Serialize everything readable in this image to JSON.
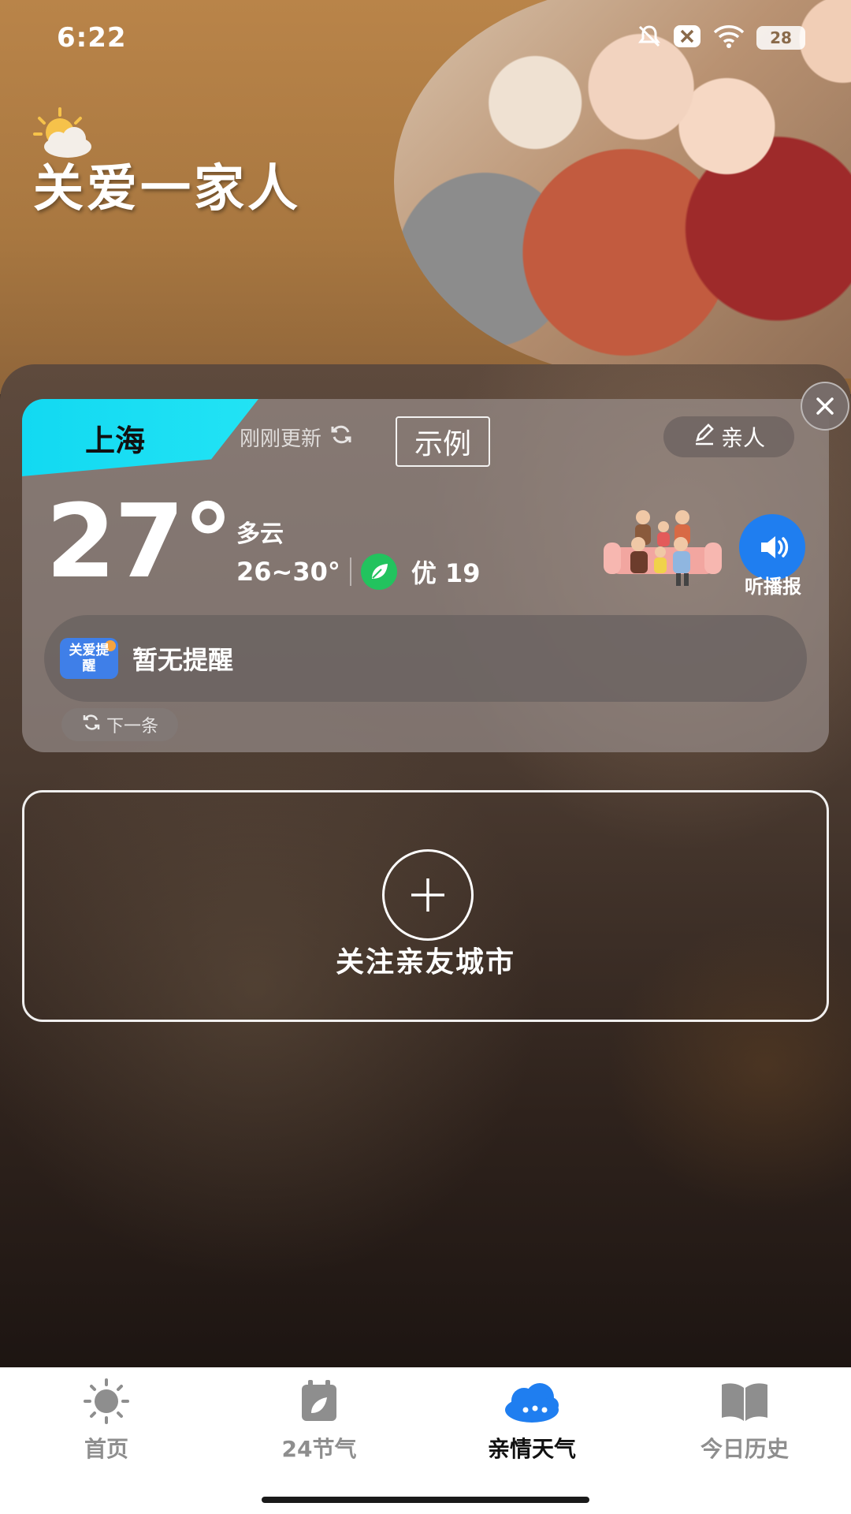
{
  "status_bar": {
    "time": "6:22",
    "battery": "28"
  },
  "hero": {
    "title": "关爱一家人"
  },
  "weather_card": {
    "city": "上海",
    "updated": "刚刚更新",
    "example_label": "示例",
    "family_label": "亲人",
    "temperature": "27°",
    "condition": "多云",
    "range": "26~30°",
    "aqi": "优 19",
    "voice_label": "听播报",
    "reminder_logo": "关爱提醒",
    "reminder_text": "暂无提醒",
    "next_label": "下一条"
  },
  "add_city": {
    "label": "关注亲友城市"
  },
  "nav": {
    "items": [
      {
        "label": "首页",
        "icon": "sun-icon",
        "active": false
      },
      {
        "label": "24节气",
        "icon": "calendar-leaf-icon",
        "active": false
      },
      {
        "label": "亲情天气",
        "icon": "cloud-icon",
        "active": true
      },
      {
        "label": "今日历史",
        "icon": "book-icon",
        "active": false
      }
    ]
  },
  "colors": {
    "accent": "#1f7ef0",
    "city_tag": "#12d9f2",
    "aqi": "#22c35e"
  }
}
